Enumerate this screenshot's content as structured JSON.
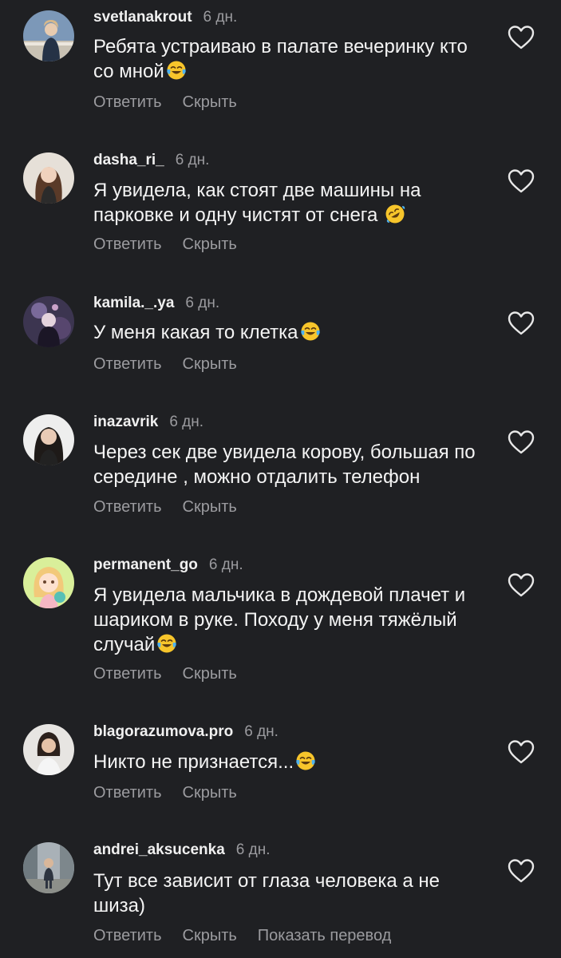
{
  "comments": [
    {
      "username": "svetlanakrout",
      "time": "6 дн.",
      "text": "Ребята устраиваю в палате вечеринку кто со мной",
      "emoji": "joy",
      "reply_label": "Ответить",
      "hide_label": "Скрыть"
    },
    {
      "username": "dasha_ri_",
      "time": "6 дн.",
      "text": "Я увидела, как стоят две машины на парковке и одну чистят от снега ",
      "emoji": "rofl",
      "reply_label": "Ответить",
      "hide_label": "Скрыть"
    },
    {
      "username": "kamila._.ya",
      "time": "6 дн.",
      "text": "У меня какая то клетка",
      "emoji": "joy",
      "reply_label": "Ответить",
      "hide_label": "Скрыть"
    },
    {
      "username": "inazavrik",
      "time": "6 дн.",
      "text": "Через сек две увидела корову, большая по середине , можно отдалить телефон",
      "emoji": "",
      "reply_label": "Ответить",
      "hide_label": "Скрыть"
    },
    {
      "username": "permanent_go",
      "time": "6 дн.",
      "text": "Я увидела мальчика в дождевой плачет и шариком в руке. Походу у меня тяжёлый случай",
      "emoji": "joy",
      "reply_label": "Ответить",
      "hide_label": "Скрыть"
    },
    {
      "username": "blagorazumova.pro",
      "time": "6 дн.",
      "text": "Никто не признается...",
      "emoji": "joy",
      "reply_label": "Ответить",
      "hide_label": "Скрыть"
    },
    {
      "username": "andrei_aksucenka",
      "time": "6 дн.",
      "text": "Тут все зависит от глаза человека а не шиза)",
      "emoji": "",
      "reply_label": "Ответить",
      "hide_label": "Скрыть",
      "translate_label": "Показать перевод"
    }
  ],
  "icons": {
    "like": "heart-outline-icon",
    "emoji_joy": "face-with-tears-of-joy-icon",
    "emoji_rofl": "rolling-on-floor-laughing-icon"
  },
  "colors": {
    "background": "#1f2023",
    "text_primary": "#f4f4f4",
    "text_secondary": "#9b9b9f",
    "emoji_yellow": "#f7c52b"
  }
}
